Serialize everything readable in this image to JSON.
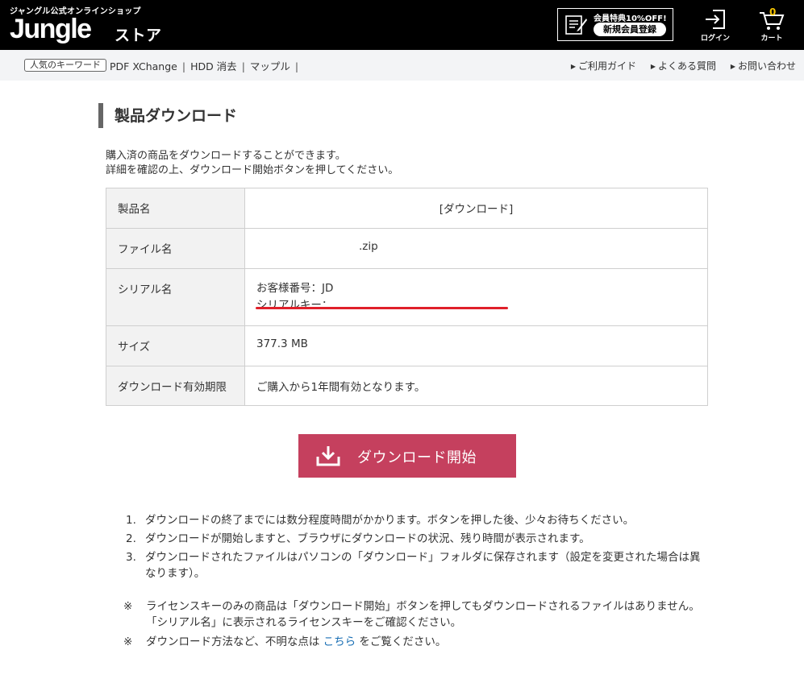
{
  "header": {
    "tagline": "ジャングル公式オンラインショップ",
    "logo": "Jungle",
    "logo_suffix": "ストア",
    "promo_top": "会員特典10%OFF!",
    "promo_button": "新規会員登録",
    "login_label": "ログイン",
    "cart_label": "カート",
    "cart_count": "0",
    "accent_color": "#f5c400"
  },
  "subnav": {
    "keyword_badge": "人気のキーワード",
    "keywords": [
      "PDF XChange",
      "HDD 消去",
      "マップル"
    ],
    "help_links": [
      "ご利用ガイド",
      "よくある質問",
      "お問い合わせ"
    ]
  },
  "main": {
    "title": "製品ダウンロード",
    "intro_line1": "購入済の商品をダウンロードすることができます。",
    "intro_line2": "詳細を確認の上、ダウンロード開始ボタンを押してください。",
    "rows": {
      "product_label": "製品名",
      "product_value": "[ダウンロード]",
      "file_label": "ファイル名",
      "file_value": ".zip",
      "serial_label": "シリアル名",
      "serial_customer": "お客様番号：JD",
      "serial_key": "シリアルキー：",
      "size_label": "サイズ",
      "size_value": "377.3 MB",
      "expiry_label": "ダウンロード有効期限",
      "expiry_value": "ご購入から1年間有効となります。"
    },
    "download_button": "ダウンロード開始",
    "button_color": "#c5405e",
    "highlight_color": "#e0202a"
  },
  "notes": [
    {
      "num": "1.",
      "text": "ダウンロードの終了までには数分程度時間がかかります。ボタンを押した後、少々お待ちください。"
    },
    {
      "num": "2.",
      "text": "ダウンロードが開始しますと、ブラウザにダウンロードの状況、残り時間が表示されます。"
    },
    {
      "num": "3.",
      "text": "ダウンロードされたファイルはパソコンの「ダウンロード」フォルダに保存されます（設定を変更された場合は異なります）。"
    }
  ],
  "caveats": {
    "mark": "※",
    "c1_line1": "ライセンスキーのみの商品は「ダウンロード開始」ボタンを押してもダウンロードされるファイルはありません。",
    "c1_line2": "「シリアル名」に表示されるライセンスキーをご確認ください。",
    "c2_before": "ダウンロード方法など、不明な点は",
    "c2_link": "こちら",
    "c2_after": "をご覧ください。"
  }
}
